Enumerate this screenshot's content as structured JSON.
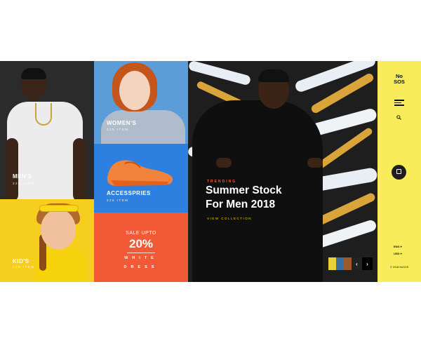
{
  "tiles": {
    "men": {
      "label": "MEN'S",
      "sub": "225 ITEM"
    },
    "kids": {
      "label": "KID'S",
      "sub": "225 ITEM"
    },
    "women": {
      "label": "WOMEN'S",
      "sub": "225 ITEM"
    },
    "accessories": {
      "label": "ACCESSPRIES",
      "sub": "225 ITEM"
    },
    "sale": {
      "top": "SALE UPTO",
      "percent": "20%",
      "line1": "WHITE",
      "line2": "DRESS"
    }
  },
  "hero": {
    "tag": "TRENDING",
    "title_line1": "Summer Stock",
    "title_line2": "For Men 2018",
    "link": "VIEW COLLECTION"
  },
  "sidebar": {
    "logo_line1": "No",
    "logo_line2": "SOS",
    "language": "ENG",
    "currency": "USD",
    "copyright": "© 2018 NoSOS"
  },
  "colors": {
    "accent_yellow": "#f9ec5a",
    "accent_orange": "#f25a37",
    "accent_blue": "#2d7fe0"
  }
}
